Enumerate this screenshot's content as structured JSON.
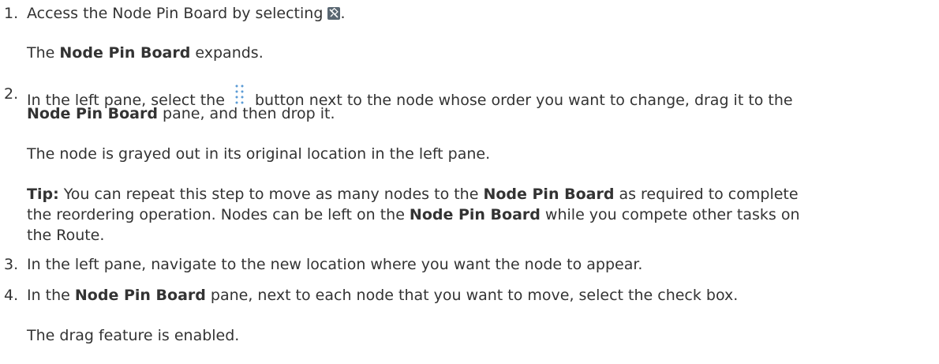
{
  "steps": [
    {
      "number": "1.",
      "text_before": "Access the Node Pin Board by selecting ",
      "icon": "pin-board-icon",
      "text_after": ".",
      "result_prefix": "The ",
      "result_bold": "Node Pin Board",
      "result_suffix": " expands."
    },
    {
      "number": "2.",
      "line1_before": "In the left pane, select the ",
      "icon": "drag-handle-icon",
      "line1_after": " button next to the node whose order you want to change, drag it to the",
      "line2_bold": "Node Pin Board",
      "line2_rest": " pane, and then drop it.",
      "result": "The node is grayed out in its original location in the left pane.",
      "tip_label": "Tip:",
      "tip_a": " You can repeat this step to move as many nodes to the ",
      "tip_b_bold": "Node Pin Board",
      "tip_c": " as required to complete",
      "tip_d": "the reordering operation. Nodes can be left on the ",
      "tip_e_bold": "Node Pin Board",
      "tip_f": " while you compete other tasks on",
      "tip_g": "the Route."
    },
    {
      "number": "3.",
      "text": "In the left pane, navigate to the new location where you want the node to appear."
    },
    {
      "number": "4.",
      "text_before": "In the ",
      "bold": "Node Pin Board",
      "text_after": " pane, next to each node that you want to move, select the check box.",
      "result": "The drag feature is enabled."
    }
  ]
}
